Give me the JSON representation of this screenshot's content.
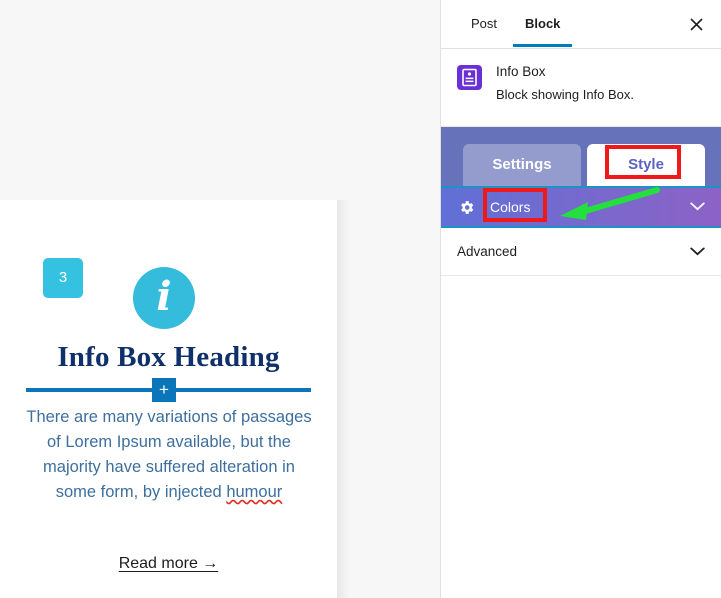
{
  "canvas": {
    "block": {
      "badge_number": "3",
      "icon_name": "info-circle-icon",
      "icon_glyph": "i",
      "heading": "Info Box Heading",
      "separator_plus": "+",
      "body_text_part1": "There are many variations of passages of Lorem Ipsum available, but the majority have suffered alteration in some form, by injected ",
      "body_text_misspelled": "humour",
      "read_more_label": "Read more →"
    }
  },
  "sidebar": {
    "tabs": [
      {
        "label": "Post",
        "active": false
      },
      {
        "label": "Block",
        "active": true
      }
    ],
    "close_label": "✕",
    "block_card": {
      "icon_name": "info-box-block-icon",
      "title": "Info Box",
      "description": "Block showing Info Box."
    },
    "plugin_panel": {
      "tabs": [
        {
          "label": "Settings",
          "active": false
        },
        {
          "label": "Style",
          "active": true
        }
      ],
      "sections": [
        {
          "label": "Colors",
          "icon": "gear-icon",
          "chevron": "chevron-down-icon",
          "expanded": false
        },
        {
          "label": "Advanced",
          "chevron": "chevron-down-icon",
          "expanded": false
        }
      ]
    }
  },
  "annotations": {
    "highlight_color": "#ef1919",
    "arrow_color": "#24e03c",
    "highlighted_elements": [
      "Style",
      "Colors"
    ]
  },
  "colors": {
    "badge": "#35c2e0",
    "info_circle": "#35bcdd",
    "heading": "#10306b",
    "separator": "#0b75ba",
    "body_text": "#3d6f9e",
    "sidebar_accent": "#007cba",
    "block_icon": "#6b2fd6",
    "plugin_tabbar": "#6672b9",
    "colors_gradient_start": "#6070d6",
    "colors_gradient_end": "#8d62c6",
    "colors_border": "#1b93c4",
    "canvas_bg": "#f7f7f7"
  }
}
